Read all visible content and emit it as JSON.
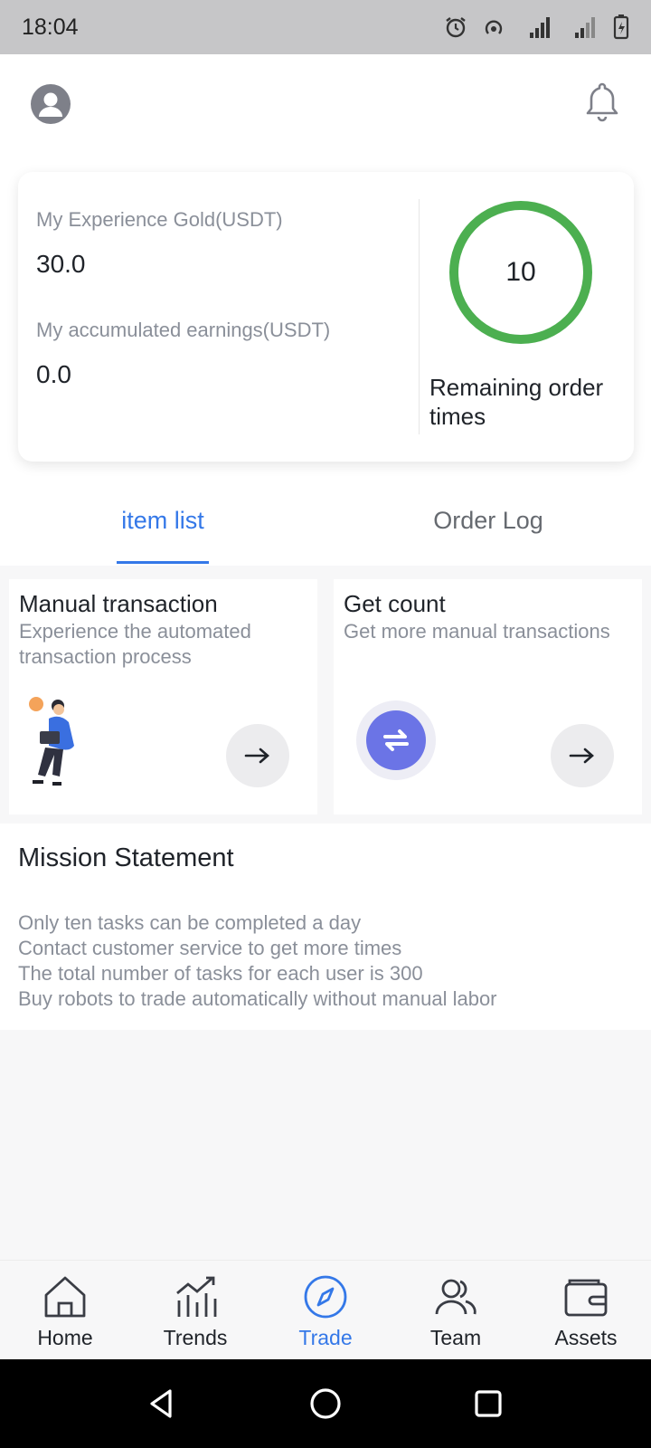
{
  "status_bar": {
    "time": "18:04"
  },
  "stats": {
    "experience_label": "My Experience Gold(USDT)",
    "experience_value": "30.0",
    "earnings_label": "My accumulated earnings(USDT)",
    "earnings_value": "0.0",
    "remaining_value": "10",
    "remaining_label": "Remaining order times",
    "ring_color": "#4caf50"
  },
  "tabs": [
    {
      "label": "item list",
      "active": true
    },
    {
      "label": "Order Log",
      "active": false
    }
  ],
  "options": [
    {
      "title": "Manual transaction",
      "desc": "Experience the automated transaction process",
      "icon": "person-laptop-illustration"
    },
    {
      "title": "Get count",
      "desc": "Get more manual transactions",
      "icon": "swap-arrows-icon"
    }
  ],
  "mission": {
    "title": "Mission Statement",
    "lines": [
      "Only ten tasks can be completed a day",
      "Contact customer service to get more times",
      "The total number of tasks for each user is 300",
      "Buy robots to trade automatically without manual labor"
    ]
  },
  "nav": [
    {
      "label": "Home",
      "icon": "home-icon",
      "active": false
    },
    {
      "label": "Trends",
      "icon": "trends-icon",
      "active": false
    },
    {
      "label": "Trade",
      "icon": "compass-icon",
      "active": true
    },
    {
      "label": "Team",
      "icon": "team-icon",
      "active": false
    },
    {
      "label": "Assets",
      "icon": "wallet-icon",
      "active": false
    }
  ],
  "colors": {
    "accent": "#3478e8",
    "ring": "#4caf50",
    "swap": "#6b74e6"
  }
}
